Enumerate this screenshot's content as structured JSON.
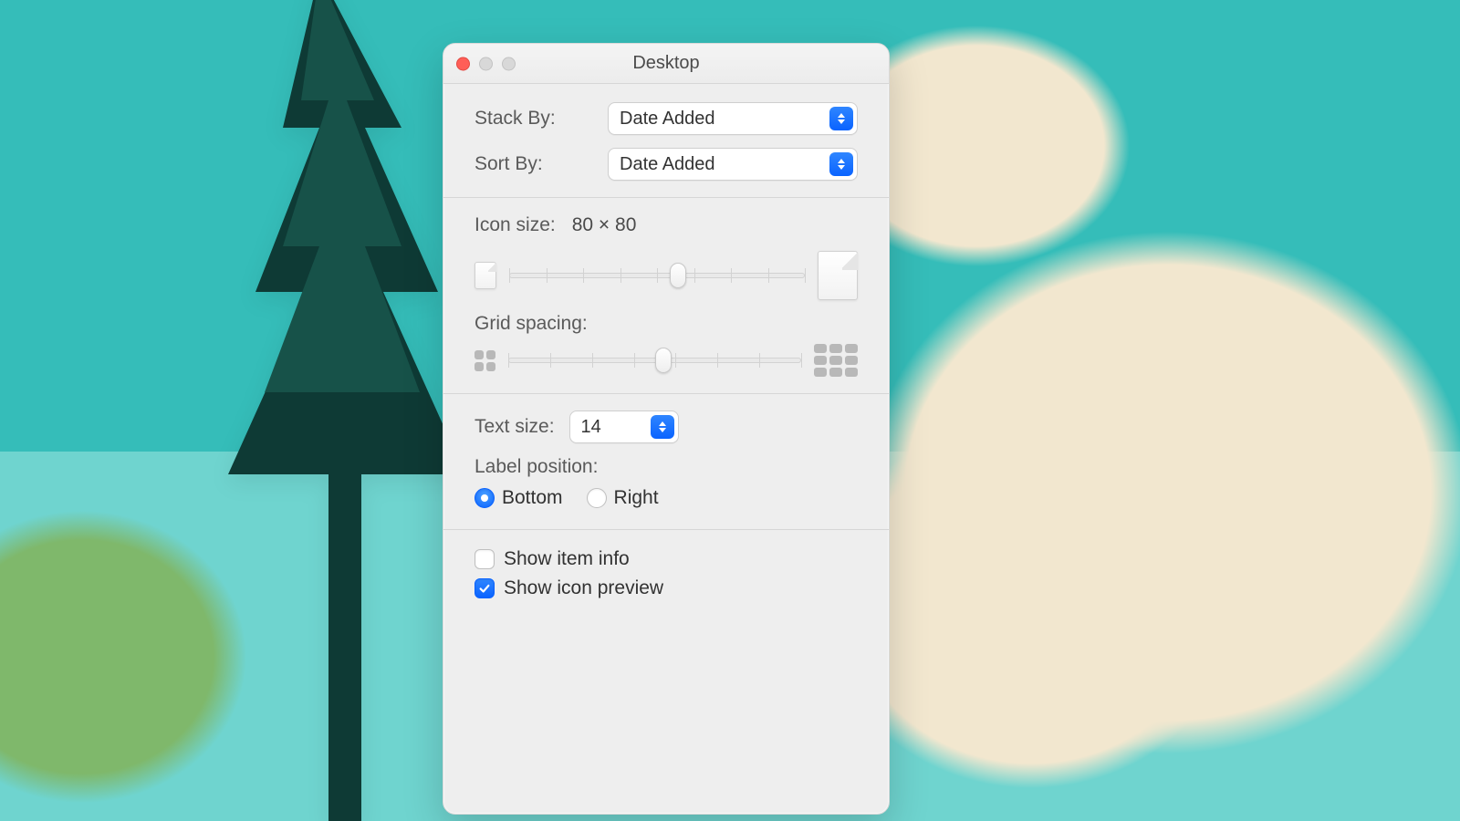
{
  "window": {
    "title": "Desktop"
  },
  "stack_by": {
    "label": "Stack By:",
    "value": "Date Added"
  },
  "sort_by": {
    "label": "Sort By:",
    "value": "Date Added"
  },
  "icon_size": {
    "label": "Icon size:",
    "value_text": "80 × 80",
    "min": 16,
    "max": 128,
    "value": 80,
    "ticks": 9,
    "percent": 57
  },
  "grid_spacing": {
    "label": "Grid spacing:",
    "ticks": 8,
    "percent": 53
  },
  "text_size": {
    "label": "Text size:",
    "value": "14"
  },
  "label_position": {
    "label": "Label position:",
    "options": {
      "bottom": "Bottom",
      "right": "Right"
    },
    "selected": "bottom"
  },
  "show_item_info": {
    "label": "Show item info",
    "checked": false
  },
  "show_icon_preview": {
    "label": "Show icon preview",
    "checked": true
  }
}
